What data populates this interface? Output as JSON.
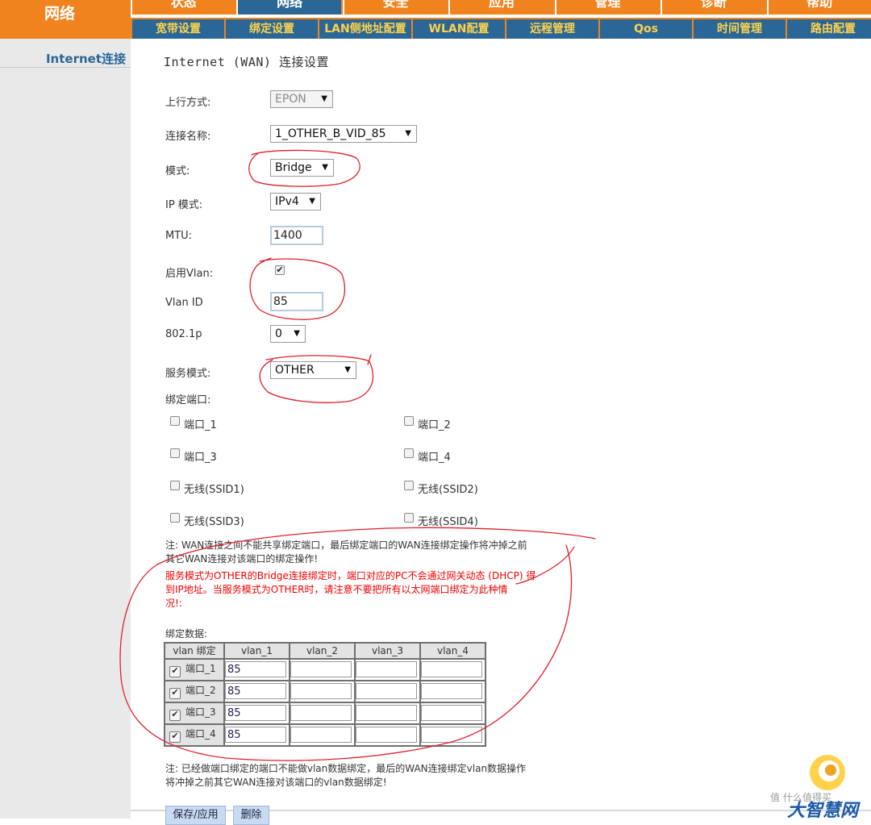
{
  "nav": {
    "side_title": "网络",
    "top_tabs": [
      "状态",
      "网络",
      "安全",
      "应用",
      "管理",
      "诊断",
      "帮助"
    ],
    "active_top_tab": 1,
    "sub_tabs": [
      "宽带设置",
      "绑定设置",
      "LAN侧地址配置",
      "WLAN配置",
      "远程管理",
      "Qos",
      "时间管理",
      "路由配置"
    ],
    "left_item": "Internet连接"
  },
  "page": {
    "title": "Internet (WAN) 连接设置"
  },
  "form": {
    "uplink": {
      "label": "上行方式:",
      "value": "EPON"
    },
    "conn_name": {
      "label": "连接名称:",
      "value": "1_OTHER_B_VID_85"
    },
    "mode": {
      "label": "模式:",
      "value": "Bridge"
    },
    "ip_mode": {
      "label": "IP 模式:",
      "value": "IPv4"
    },
    "mtu": {
      "label": "MTU:",
      "value": "1400"
    },
    "vlan_enable": {
      "label": "启用Vlan:",
      "checked": true
    },
    "vlan_id": {
      "label": "Vlan ID",
      "value": "85"
    },
    "p8021": {
      "label": "802.1p",
      "value": "0"
    },
    "service_mode": {
      "label": "服务模式:",
      "value": "OTHER"
    },
    "bind_ports_label": "绑定端口:",
    "ports": [
      {
        "label": "端口_1",
        "checked": false
      },
      {
        "label": "端口_2",
        "checked": false
      },
      {
        "label": "端口_3",
        "checked": false
      },
      {
        "label": "端口_4",
        "checked": false
      },
      {
        "label": "无线(SSID1)",
        "checked": false
      },
      {
        "label": "无线(SSID2)",
        "checked": false
      },
      {
        "label": "无线(SSID3)",
        "checked": false
      },
      {
        "label": "无线(SSID4)",
        "checked": false
      }
    ]
  },
  "notes": {
    "note1_line1": "注: WAN连接之间不能共享绑定端口，最后绑定端口的WAN连接绑定操作将冲掉之前",
    "note1_line2": "其它WAN连接对该端口的绑定操作!",
    "warn_line1": "服务模式为OTHER的Bridge连接绑定时，端口对应的PC不会通过网关动态 (DHCP) 得",
    "warn_line2": "到IP地址。当服务模式为OTHER时，请注意不要把所有以太网端口绑定为此种情",
    "warn_line3": "况!:",
    "bind_data_label": "绑定数据:",
    "note2_line1": "注: 已经做端口绑定的端口不能做vlan数据绑定，最后的WAN连接绑定vlan数据操作",
    "note2_line2": "将冲掉之前其它WAN连接对该端口的vlan数据绑定!"
  },
  "bind_table": {
    "headers": [
      "vlan 绑定",
      "vlan_1",
      "vlan_2",
      "vlan_3",
      "vlan_4"
    ],
    "rows": [
      {
        "port": "端口_1",
        "checked": true,
        "vlans": [
          "85",
          "",
          "",
          ""
        ]
      },
      {
        "port": "端口_2",
        "checked": true,
        "vlans": [
          "85",
          "",
          "",
          ""
        ]
      },
      {
        "port": "端口_3",
        "checked": true,
        "vlans": [
          "85",
          "",
          "",
          ""
        ]
      },
      {
        "port": "端口_4",
        "checked": true,
        "vlans": [
          "85",
          "",
          "",
          ""
        ]
      }
    ]
  },
  "buttons": {
    "save": "保存/应用",
    "delete": "删除"
  },
  "watermark": "值 什么值得买",
  "logo_text": "大智慧网",
  "colors": {
    "orange": "#f0831e",
    "blue": "#2a6797",
    "yellow": "#ffd24a",
    "annotation_red": "#e0202a",
    "warning_red": "#ee0000"
  }
}
